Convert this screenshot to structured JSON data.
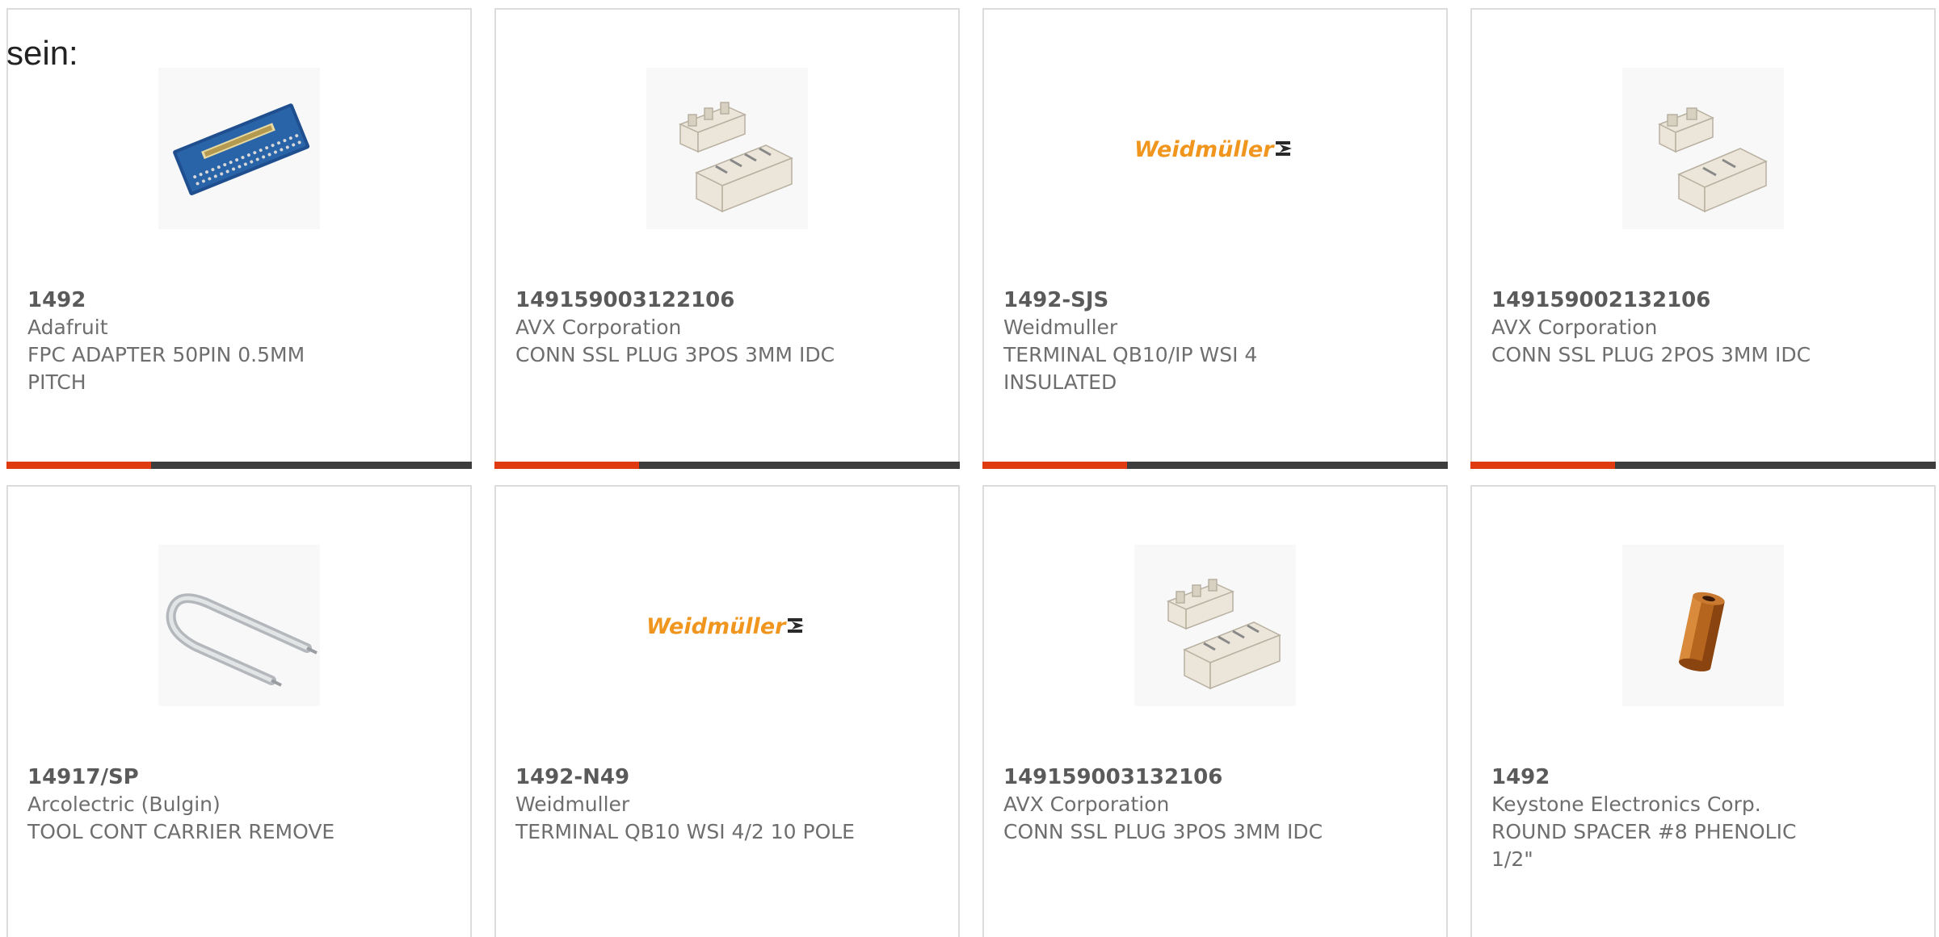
{
  "intro_text": "sein:",
  "colors": {
    "card_border": "#dcdcdc",
    "text": "#6e6e6e",
    "bar_dark": "#3d3d3d",
    "bar_accent": "#e03a10"
  },
  "cards": [
    {
      "part_number": "1492",
      "manufacturer": "Adafruit",
      "description": "FPC ADAPTER 50PIN 0.5MM PITCH",
      "image": "fpc-adapter-board",
      "progress": 0.31
    },
    {
      "part_number": "149159003122106",
      "manufacturer": "AVX Corporation",
      "description": "CONN SSL PLUG 3POS 3MM IDC",
      "image": "ssl-plug-connector",
      "progress": 0.31
    },
    {
      "part_number": "1492-SJS",
      "manufacturer": "Weidmuller",
      "description": "TERMINAL QB10/IP WSI 4 INSULATED",
      "image": "weidmuller-logo",
      "logo_text": "Weidmüller",
      "progress": 0.31
    },
    {
      "part_number": "149159002132106",
      "manufacturer": "AVX Corporation",
      "description": "CONN SSL PLUG 2POS 3MM IDC",
      "image": "ssl-plug-connector-2pos",
      "progress": 0.31
    },
    {
      "part_number": "14917/SP",
      "manufacturer": "Arcolectric (Bulgin)",
      "description": "TOOL CONT CARRIER REMOVE",
      "image": "removal-tool"
    },
    {
      "part_number": "1492-N49",
      "manufacturer": "Weidmuller",
      "description": "TERMINAL QB10 WSI 4/2 10 POLE",
      "image": "weidmuller-logo",
      "logo_text": "Weidmüller"
    },
    {
      "part_number": "149159003132106",
      "manufacturer": "AVX Corporation",
      "description": "CONN SSL PLUG 3POS 3MM IDC",
      "image": "ssl-plug-connector"
    },
    {
      "part_number": "1492",
      "manufacturer": "Keystone Electronics Corp.",
      "description": "ROUND SPACER #8 PHENOLIC 1/2\"",
      "image": "round-spacer"
    }
  ]
}
